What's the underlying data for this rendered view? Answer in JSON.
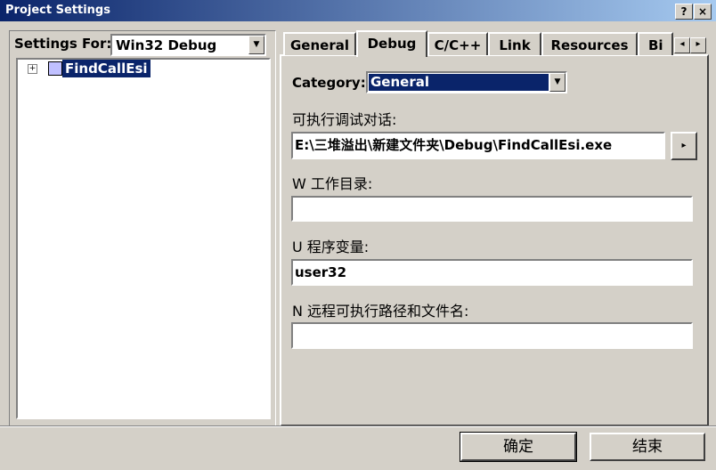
{
  "window": {
    "title": "Project Settings",
    "help_btn": "?",
    "close_btn": "×"
  },
  "left": {
    "settings_for_label": "Settings For:",
    "settings_for_value": "Win32 Debug",
    "tree": [
      {
        "label": "FindCallEsi",
        "expander": "+"
      }
    ]
  },
  "tabs": [
    {
      "label": "General"
    },
    {
      "label": "Debug",
      "selected": true
    },
    {
      "label": "C/C++"
    },
    {
      "label": "Link"
    },
    {
      "label": "Resources"
    },
    {
      "label": "Bi"
    }
  ],
  "tab_scroll": {
    "left": "◂",
    "right": "▸"
  },
  "debug": {
    "category_label": "Category:",
    "category_value": "General",
    "executable_label": "可执行调试对话:",
    "executable_value": "E:\\三堆溢出\\新建文件夹\\Debug\\FindCallEsi.exe",
    "browse_btn": "▸",
    "workdir_label": "W 工作目录:",
    "workdir_value": "",
    "args_label": "U 程序变量:",
    "args_value": "user32",
    "remote_label": "N 远程可执行路径和文件名:",
    "remote_value": ""
  },
  "buttons": {
    "ok": "确定",
    "cancel": "结束"
  },
  "colors": {
    "face": "#d4d0c8",
    "title_start": "#0a246a",
    "title_end": "#a6caf0",
    "selection": "#0a246a"
  }
}
